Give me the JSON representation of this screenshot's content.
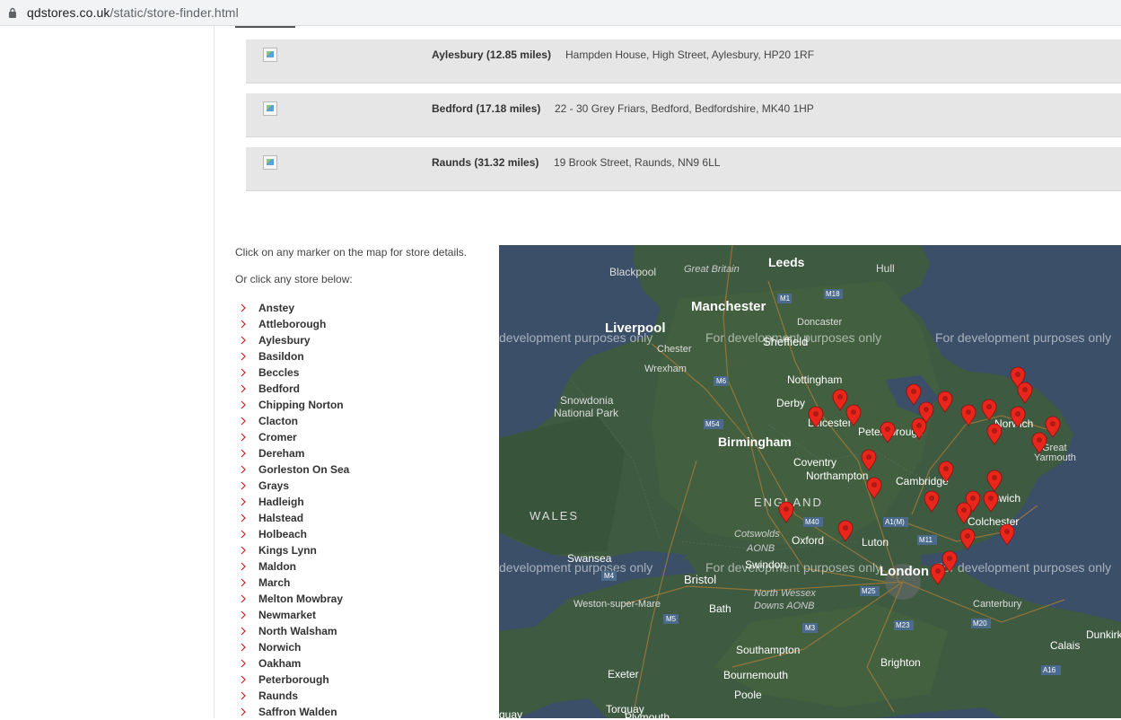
{
  "browser": {
    "url_domain": "qdstores.co.uk",
    "url_path": "/static/store-finder.html"
  },
  "results": [
    {
      "name": "Aylesbury (12.85 miles)",
      "address": "Hampden House, High Street, Aylesbury, HP20 1RF"
    },
    {
      "name": "Bedford (17.18 miles)",
      "address": "22 - 30 Grey Friars, Bedford, Bedfordshire, MK40 1HP"
    },
    {
      "name": "Raunds (31.32 miles)",
      "address": "19 Brook Street, Raunds, NN9 6LL"
    }
  ],
  "intro": {
    "line1": "Click on any marker on the map for store details.",
    "line2": "Or click any store below:"
  },
  "stores": [
    "Anstey",
    "Attleborough",
    "Aylesbury",
    "Basildon",
    "Beccles",
    "Bedford",
    "Chipping Norton",
    "Clacton",
    "Cromer",
    "Dereham",
    "Gorleston On Sea",
    "Grays",
    "Hadleigh",
    "Halstead",
    "Holbeach",
    "Kings Lynn",
    "Maldon",
    "March",
    "Melton Mowbray",
    "Newmarket",
    "North Walsham",
    "Norwich",
    "Oakham",
    "Peterborough",
    "Raunds",
    "Saffron Walden"
  ],
  "map": {
    "watermark": "For development purposes only",
    "watermark_partial": "development purposes only",
    "labels": {
      "leeds": "Leeds",
      "blackpool": "Blackpool",
      "great_britain": "Great Britain",
      "hull": "Hull",
      "manchester": "Manchester",
      "liverpool": "Liverpool",
      "doncaster": "Doncaster",
      "sheffield": "Sheffield",
      "chester": "Chester",
      "wrexham": "Wrexham",
      "nottingham": "Nottingham",
      "snowdonia": "Snowdonia",
      "national_park": "National Park",
      "derby": "Derby",
      "leicester": "Leicester",
      "peterborough": "Peterborough",
      "norwich": "Norwich",
      "great": "Great",
      "yarmouth": "Yarmouth",
      "birmingham": "Birmingham",
      "coventry": "Coventry",
      "northampton": "Northampton",
      "cambridge": "Cambridge",
      "ipswich": "Ipswich",
      "england": "ENGLAND",
      "wales": "WALES",
      "cotswolds": "Cotswolds",
      "aonb": "AONB",
      "oxford": "Oxford",
      "luton": "Luton",
      "colchester": "Colchester",
      "swansea": "Swansea",
      "bristol": "Bristol",
      "swindon": "Swindon",
      "london": "London",
      "weston": "Weston-super-Mare",
      "bath": "Bath",
      "north_wessex": "North Wessex",
      "downs_aonb": "Downs AONB",
      "canterbury": "Canterbury",
      "southampton": "Southampton",
      "exeter": "Exeter",
      "bournemouth": "Bournemouth",
      "brighton": "Brighton",
      "poole": "Poole",
      "torquay": "Torquay",
      "calais": "Calais",
      "dunkirk": "Dunkirk",
      "plymouth": "Plymouth",
      "quay": "quay",
      "m1": "M1",
      "m18": "M18",
      "m6": "M6",
      "m54": "M54",
      "m40": "M40",
      "m4": "M4",
      "m5": "M5",
      "m3": "M3",
      "m23": "M23",
      "m20": "M20",
      "m25": "M25",
      "m11": "M11",
      "a1m": "A1(M)",
      "a16": "A16"
    }
  },
  "colors": {
    "marker": "#e8261c",
    "chevron": "#d11d1d",
    "row_bg": "#e6e6e6"
  }
}
